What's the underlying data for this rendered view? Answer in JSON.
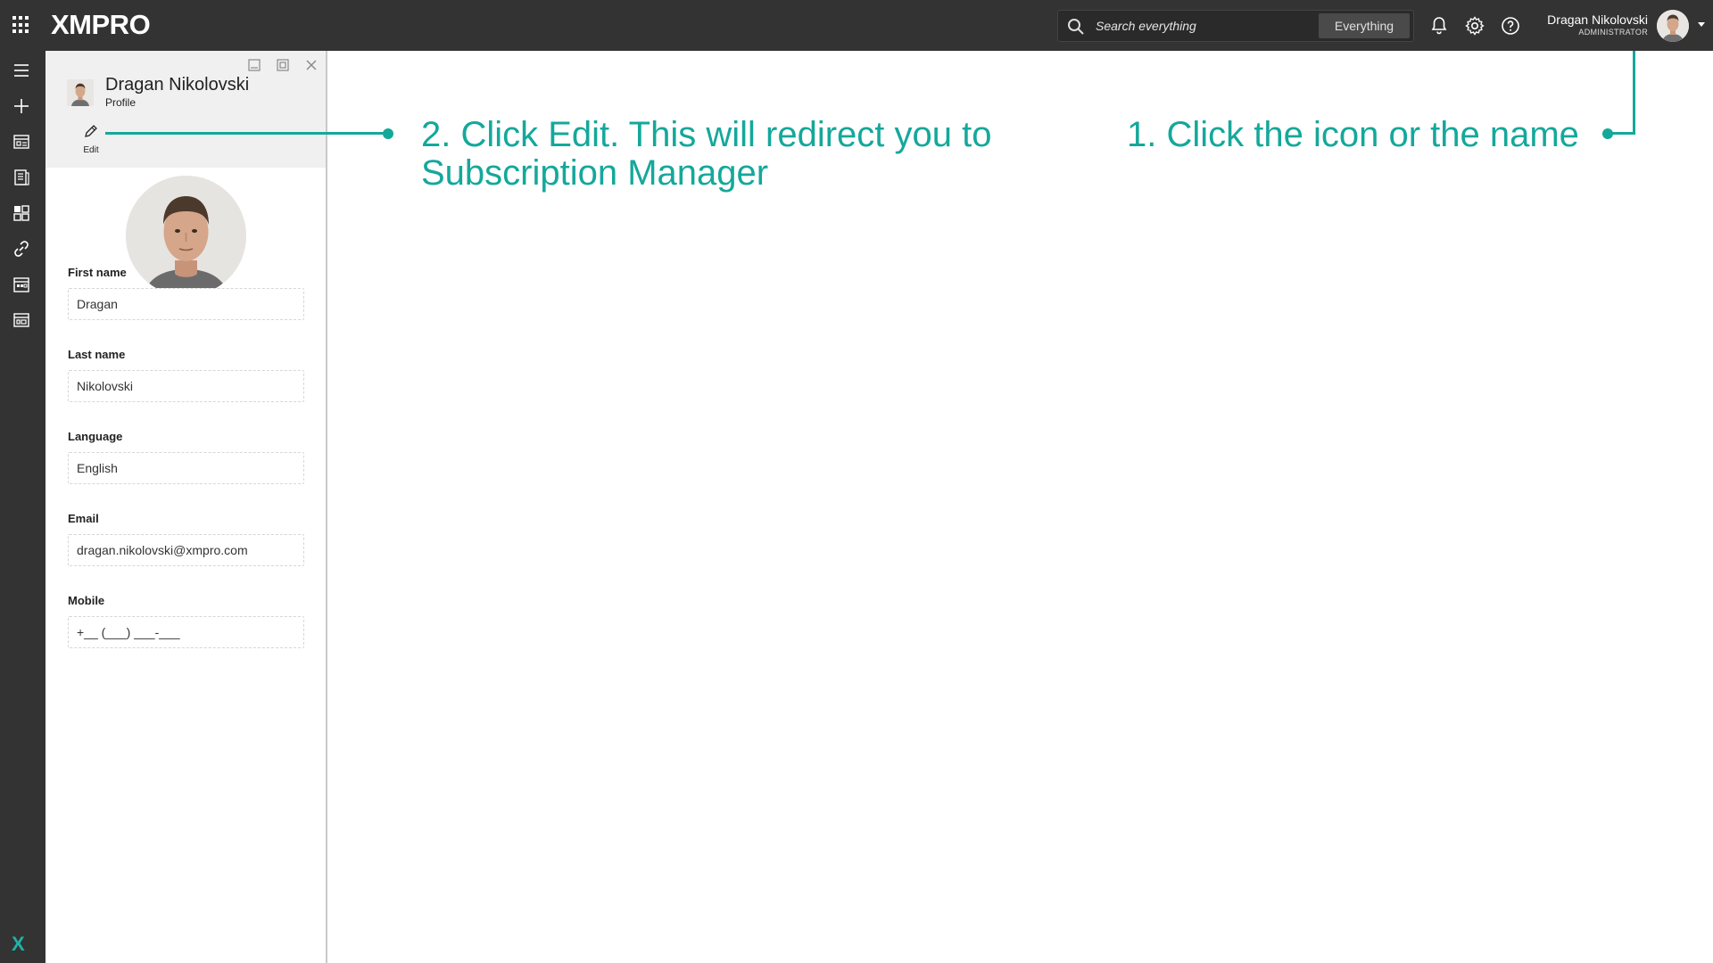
{
  "topbar": {
    "logo_text": "XMPRO",
    "search": {
      "placeholder": "Search everything",
      "scope": "Everything"
    },
    "user": {
      "name": "Dragan Nikolovski",
      "role": "ADMINISTRATOR"
    },
    "icons": [
      "apps-grid-icon",
      "search-icon",
      "bell-icon",
      "gear-icon",
      "help-icon",
      "caret-down-icon"
    ]
  },
  "rail": {
    "icons": [
      "menu-icon",
      "plus-icon",
      "app-designer-icon",
      "data-stream-icon",
      "recommendations-icon",
      "link-icon",
      "calendar-icon",
      "dashboard-icon",
      "xmpro-x-icon"
    ]
  },
  "profile": {
    "title": "Dragan Nikolovski",
    "subtitle": "Profile",
    "edit_label": "Edit",
    "fields": [
      {
        "label": "First name",
        "value": "Dragan"
      },
      {
        "label": "Last name",
        "value": "Nikolovski"
      },
      {
        "label": "Language",
        "value": "English"
      },
      {
        "label": "Email",
        "value": "dragan.nikolovski@xmpro.com"
      },
      {
        "label": "Mobile",
        "value": "+__ (___) ___-___"
      }
    ]
  },
  "annotations": {
    "step1": "1. Click the icon or the name",
    "step2_line1": "2. Click Edit. This will redirect you to",
    "step2_line2": "Subscription Manager"
  },
  "colors": {
    "topbar": "#333333",
    "accent": "#14a89b",
    "panel_header": "#f0f0f0"
  }
}
